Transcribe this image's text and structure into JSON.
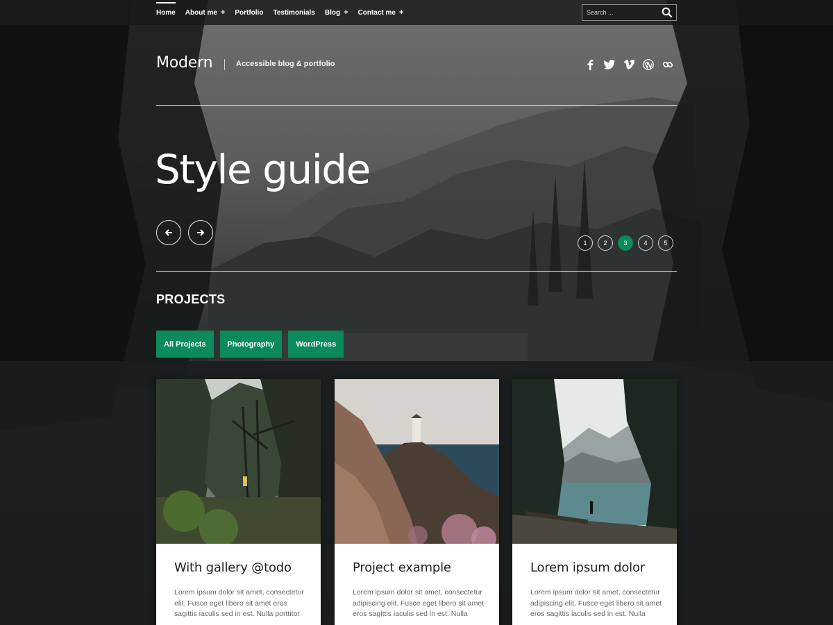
{
  "nav": {
    "items": [
      {
        "label": "Home",
        "has_submenu": false,
        "active": true
      },
      {
        "label": "About me",
        "has_submenu": true,
        "active": false
      },
      {
        "label": "Portfolio",
        "has_submenu": false,
        "active": false
      },
      {
        "label": "Testimonials",
        "has_submenu": false,
        "active": false
      },
      {
        "label": "Blog",
        "has_submenu": true,
        "active": false
      },
      {
        "label": "Contact me",
        "has_submenu": true,
        "active": false
      }
    ],
    "submenu_indicator": "+"
  },
  "search": {
    "placeholder": "Search ..."
  },
  "header": {
    "site_title": "Modern",
    "tagline": "Accessible blog & portfolio",
    "social": [
      "facebook-icon",
      "twitter-icon",
      "vimeo-icon",
      "wordpress-icon",
      "link-icon"
    ]
  },
  "hero": {
    "title": "Style guide",
    "slides": [
      "1",
      "2",
      "3",
      "4",
      "5"
    ],
    "active_slide": "3"
  },
  "projects": {
    "heading": "PROJECTS",
    "filters": [
      "All Projects",
      "Photography",
      "WordPress"
    ],
    "cards": [
      {
        "title": "With gallery @todo",
        "excerpt": "Lorem ipsum dolor sit amet, consectetur elit. Fusce eget libero sit amet eros sagittis iaculis sed in est. Nulla porttitor"
      },
      {
        "title": "Project example",
        "excerpt": "Lorem ipsum dolor sit amet, consectetur adipiscing elit. Fusce eget libero sit amet eros sagittis iaculis sed in est. Nulla"
      },
      {
        "title": "Lorem ipsum dolor",
        "excerpt": "Lorem ipsum dolor sit amet, consectetur adipiscing elit. Fusce eget libero sit amet eros sagittis iaculis sed in est. Nulla"
      }
    ]
  },
  "colors": {
    "accent": "#0b8a5c",
    "nav_bg": "#181a1b",
    "page_bg": "#1a1c1e",
    "card_bg": "#ffffff",
    "card_title": "#222222",
    "card_text": "#666666"
  }
}
